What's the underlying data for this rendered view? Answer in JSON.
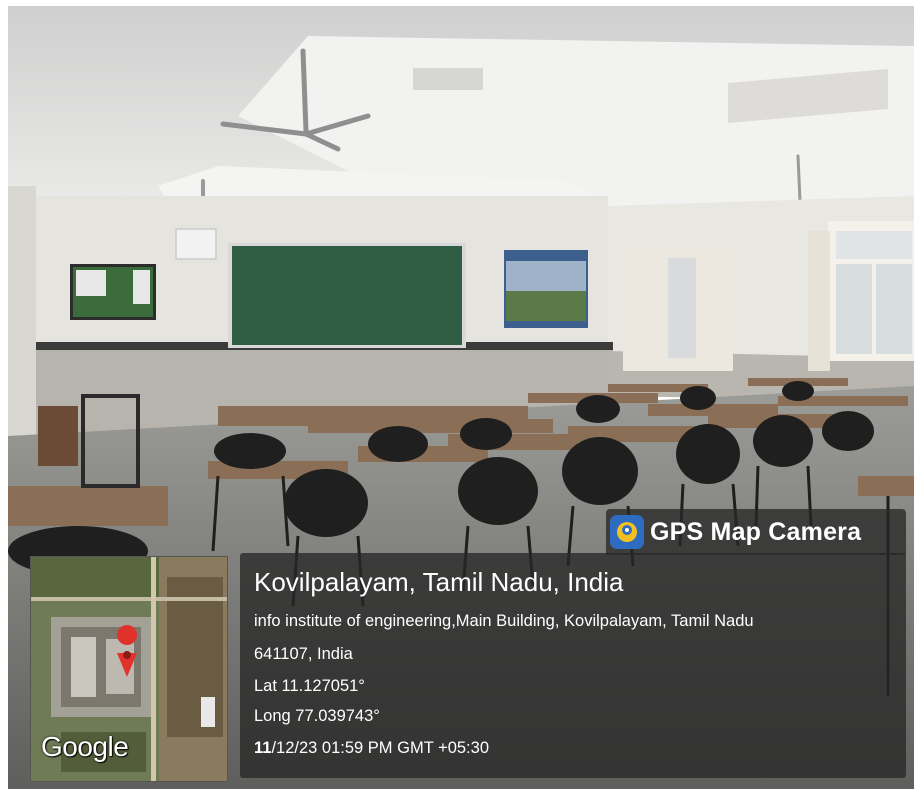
{
  "watermark": {
    "brand": "GPS Map Camera",
    "map_attribution": "Google",
    "place_title": "Kovilpalayam, Tamil Nadu, India",
    "address_line1": "info institute of engineering,Main Building, Kovilpalayam, Tamil Nadu",
    "address_line2": "641107, India",
    "latitude": "Lat 11.127051°",
    "longitude": "Long 77.039743°",
    "datetime_day": "11",
    "datetime_rest": "/12/23 01:59 PM GMT +05:30"
  },
  "colors": {
    "panel": "#282828",
    "board": "#2f5e44",
    "wall": "#e6e4df",
    "pin": "#e0322b"
  }
}
